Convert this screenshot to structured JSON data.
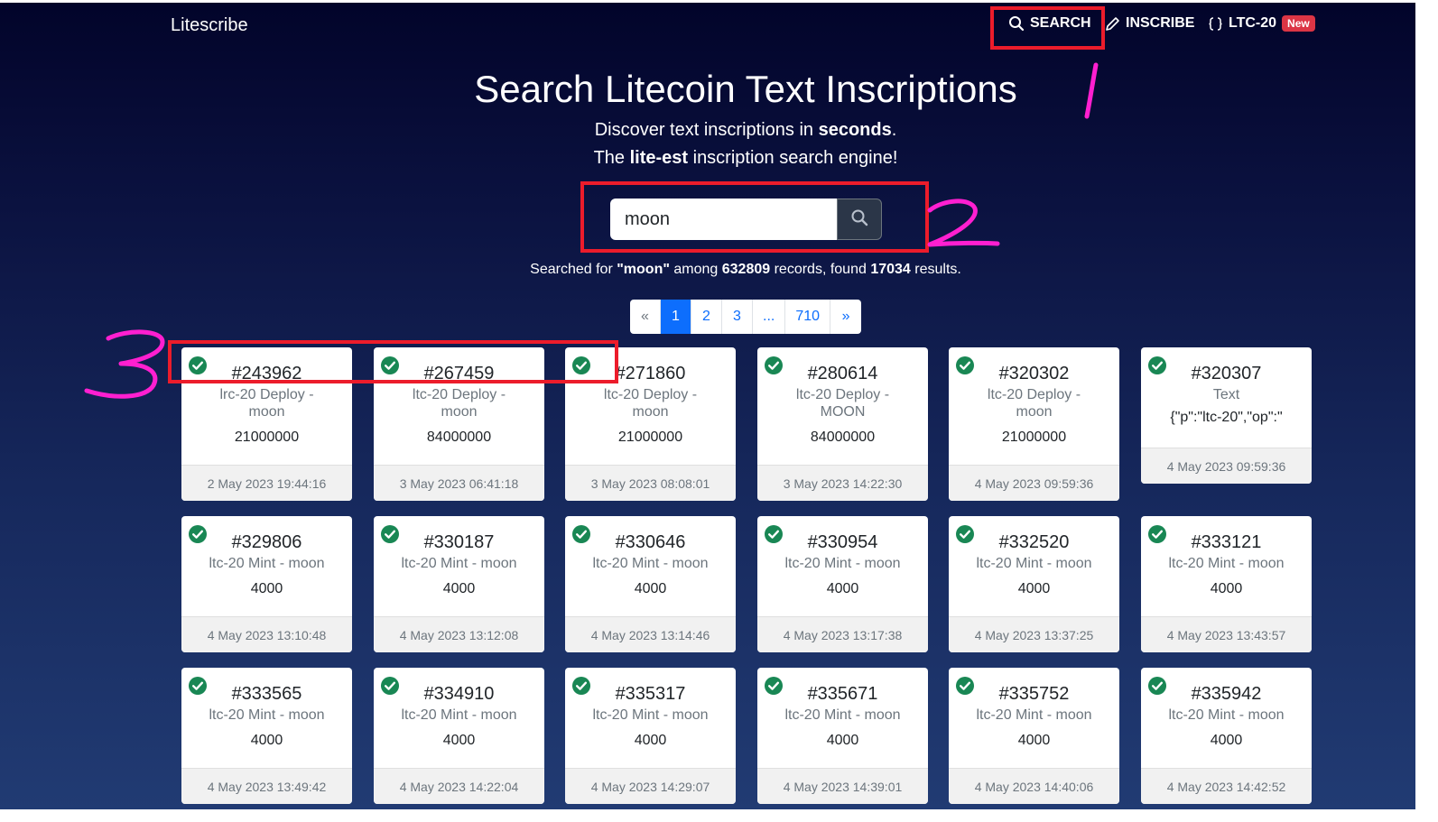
{
  "nav": {
    "brand": "Litescribe",
    "search": "SEARCH",
    "inscribe": "INSCRIBE",
    "ltc20": "LTC-20",
    "new_badge": "New"
  },
  "hero": {
    "title": "Search Litecoin Text Inscriptions",
    "line1_a": "Discover text inscriptions in ",
    "line1_b": "seconds",
    "line1_c": ".",
    "line2_a": "The ",
    "line2_b": "lite-est",
    "line2_c": " inscription search engine!"
  },
  "search": {
    "value": "moon"
  },
  "results": {
    "prefix": "Searched for ",
    "query": "\"moon\"",
    "among": " among ",
    "records": "632809",
    "records_suffix": " records, found ",
    "found": "17034",
    "found_suffix": " results."
  },
  "pagination": [
    "«",
    "1",
    "2",
    "3",
    "...",
    "710",
    "»"
  ],
  "cards": [
    {
      "num": "#243962",
      "type1": "lrc-20 Deploy -",
      "type2": "moon",
      "val": "21000000",
      "date": "2 May 2023 19:44:16"
    },
    {
      "num": "#267459",
      "type1": "ltc-20 Deploy -",
      "type2": "moon",
      "val": "84000000",
      "date": "3 May 2023 06:41:18"
    },
    {
      "num": "#271860",
      "type1": "ltc-20 Deploy -",
      "type2": "moon",
      "val": "21000000",
      "date": "3 May 2023 08:08:01"
    },
    {
      "num": "#280614",
      "type1": "ltc-20 Deploy -",
      "type2": "MOON",
      "val": "84000000",
      "date": "3 May 2023 14:22:30"
    },
    {
      "num": "#320302",
      "type1": "ltc-20 Deploy -",
      "type2": "moon",
      "val": "21000000",
      "date": "4 May 2023 09:59:36"
    },
    {
      "num": "#320307",
      "type1": "Text",
      "type2": "",
      "val": "{\"p\":\"ltc-20\",\"op\":\"",
      "date": "4 May 2023 09:59:36"
    },
    {
      "num": "#329806",
      "type1": "ltc-20 Mint - moon",
      "type2": "",
      "val": "4000",
      "date": "4 May 2023 13:10:48"
    },
    {
      "num": "#330187",
      "type1": "ltc-20 Mint - moon",
      "type2": "",
      "val": "4000",
      "date": "4 May 2023 13:12:08"
    },
    {
      "num": "#330646",
      "type1": "ltc-20 Mint - moon",
      "type2": "",
      "val": "4000",
      "date": "4 May 2023 13:14:46"
    },
    {
      "num": "#330954",
      "type1": "ltc-20 Mint - moon",
      "type2": "",
      "val": "4000",
      "date": "4 May 2023 13:17:38"
    },
    {
      "num": "#332520",
      "type1": "ltc-20 Mint - moon",
      "type2": "",
      "val": "4000",
      "date": "4 May 2023 13:37:25"
    },
    {
      "num": "#333121",
      "type1": "ltc-20 Mint - moon",
      "type2": "",
      "val": "4000",
      "date": "4 May 2023 13:43:57"
    },
    {
      "num": "#333565",
      "type1": "ltc-20 Mint - moon",
      "type2": "",
      "val": "4000",
      "date": "4 May 2023 13:49:42"
    },
    {
      "num": "#334910",
      "type1": "ltc-20 Mint - moon",
      "type2": "",
      "val": "4000",
      "date": "4 May 2023 14:22:04"
    },
    {
      "num": "#335317",
      "type1": "ltc-20 Mint - moon",
      "type2": "",
      "val": "4000",
      "date": "4 May 2023 14:29:07"
    },
    {
      "num": "#335671",
      "type1": "ltc-20 Mint - moon",
      "type2": "",
      "val": "4000",
      "date": "4 May 2023 14:39:01"
    },
    {
      "num": "#335752",
      "type1": "ltc-20 Mint - moon",
      "type2": "",
      "val": "4000",
      "date": "4 May 2023 14:40:06"
    },
    {
      "num": "#335942",
      "type1": "ltc-20 Mint - moon",
      "type2": "",
      "val": "4000",
      "date": "4 May 2023 14:42:52"
    }
  ],
  "annotations": {
    "one": "1",
    "two": "2",
    "three": "3"
  },
  "colors": {
    "bg_top": "#02042a",
    "bg_bottom": "#213b73",
    "accent": "#0d6efd",
    "check": "#198754",
    "annotation_box": "#ec1c2b",
    "annotation_ink": "#ff1fd0",
    "badge": "#dc3545"
  }
}
